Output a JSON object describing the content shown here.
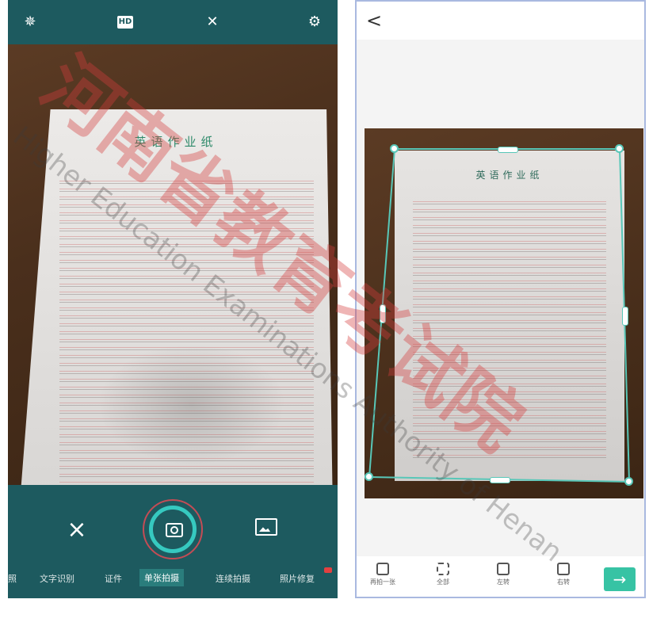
{
  "left_screen": {
    "top_icons": [
      "flash-auto-icon",
      "hd-icon",
      "grid-off-icon",
      "settings-icon"
    ],
    "top_glyphs": [
      "✵",
      "HD",
      "✕",
      "⚙"
    ],
    "paper": {
      "title": "英语作业纸"
    },
    "bottom": {
      "close_glyph": "×",
      "modes": [
        {
          "label": "照"
        },
        {
          "label": "文字识别"
        },
        {
          "label": "证件"
        },
        {
          "label": "单张拍摄",
          "active": true
        },
        {
          "label": "连续拍摄"
        },
        {
          "label": "照片修复",
          "badge": true
        }
      ]
    }
  },
  "right_screen": {
    "back_glyph": "<",
    "paper": {
      "title": "英语作业纸"
    },
    "tools": [
      "再拍一张",
      "全部",
      "左转",
      "右转"
    ],
    "next_glyph": "→"
  },
  "watermark": {
    "cn": "河南省教育考试院",
    "en": "Higher Education Examinations Authority of Henan"
  },
  "colors": {
    "bar": "#1d5a5f",
    "shutter_ring": "#36c9c0",
    "highlight_circle": "#c44c55",
    "next_button": "#37c3a4",
    "crop_border": "#58c7b8"
  }
}
